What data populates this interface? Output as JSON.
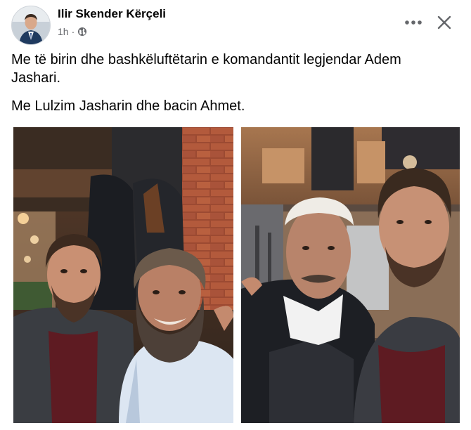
{
  "post": {
    "author": "Ilir Skender Kërçeli",
    "time": "1h",
    "time_separator": "·",
    "privacy_icon": "globe-icon",
    "text_line1": "Me të birin dhe bashkëluftëtarin e komandantit legjendar Adem Jashari.",
    "text_line2": "Me Lulzim Jasharin dhe bacin Ahmet."
  },
  "actions": {
    "more_icon": "more-options-icon",
    "close_icon": "close-icon"
  },
  "photos": [
    {
      "name": "photo-selfie-bearded-man"
    },
    {
      "name": "photo-selfie-elder-with-plis"
    }
  ],
  "colors": {
    "text": "#050505",
    "secondary": "#65676b",
    "background": "#ffffff"
  }
}
